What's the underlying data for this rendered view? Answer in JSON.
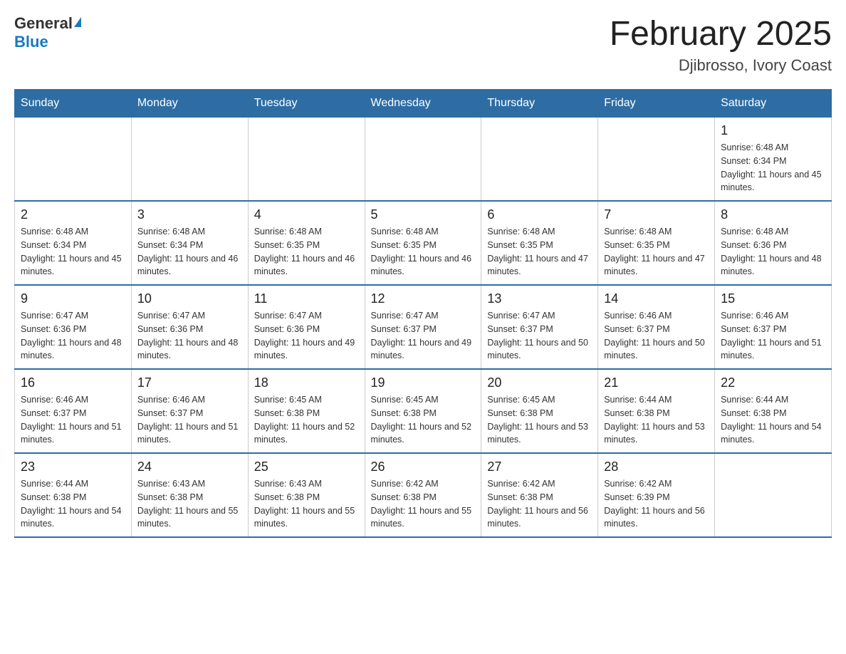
{
  "header": {
    "logo_general": "General",
    "logo_blue": "Blue",
    "month_title": "February 2025",
    "location": "Djibrosso, Ivory Coast"
  },
  "days_of_week": [
    "Sunday",
    "Monday",
    "Tuesday",
    "Wednesday",
    "Thursday",
    "Friday",
    "Saturday"
  ],
  "weeks": [
    [
      {
        "day": "",
        "info": ""
      },
      {
        "day": "",
        "info": ""
      },
      {
        "day": "",
        "info": ""
      },
      {
        "day": "",
        "info": ""
      },
      {
        "day": "",
        "info": ""
      },
      {
        "day": "",
        "info": ""
      },
      {
        "day": "1",
        "info": "Sunrise: 6:48 AM\nSunset: 6:34 PM\nDaylight: 11 hours and 45 minutes."
      }
    ],
    [
      {
        "day": "2",
        "info": "Sunrise: 6:48 AM\nSunset: 6:34 PM\nDaylight: 11 hours and 45 minutes."
      },
      {
        "day": "3",
        "info": "Sunrise: 6:48 AM\nSunset: 6:34 PM\nDaylight: 11 hours and 46 minutes."
      },
      {
        "day": "4",
        "info": "Sunrise: 6:48 AM\nSunset: 6:35 PM\nDaylight: 11 hours and 46 minutes."
      },
      {
        "day": "5",
        "info": "Sunrise: 6:48 AM\nSunset: 6:35 PM\nDaylight: 11 hours and 46 minutes."
      },
      {
        "day": "6",
        "info": "Sunrise: 6:48 AM\nSunset: 6:35 PM\nDaylight: 11 hours and 47 minutes."
      },
      {
        "day": "7",
        "info": "Sunrise: 6:48 AM\nSunset: 6:35 PM\nDaylight: 11 hours and 47 minutes."
      },
      {
        "day": "8",
        "info": "Sunrise: 6:48 AM\nSunset: 6:36 PM\nDaylight: 11 hours and 48 minutes."
      }
    ],
    [
      {
        "day": "9",
        "info": "Sunrise: 6:47 AM\nSunset: 6:36 PM\nDaylight: 11 hours and 48 minutes."
      },
      {
        "day": "10",
        "info": "Sunrise: 6:47 AM\nSunset: 6:36 PM\nDaylight: 11 hours and 48 minutes."
      },
      {
        "day": "11",
        "info": "Sunrise: 6:47 AM\nSunset: 6:36 PM\nDaylight: 11 hours and 49 minutes."
      },
      {
        "day": "12",
        "info": "Sunrise: 6:47 AM\nSunset: 6:37 PM\nDaylight: 11 hours and 49 minutes."
      },
      {
        "day": "13",
        "info": "Sunrise: 6:47 AM\nSunset: 6:37 PM\nDaylight: 11 hours and 50 minutes."
      },
      {
        "day": "14",
        "info": "Sunrise: 6:46 AM\nSunset: 6:37 PM\nDaylight: 11 hours and 50 minutes."
      },
      {
        "day": "15",
        "info": "Sunrise: 6:46 AM\nSunset: 6:37 PM\nDaylight: 11 hours and 51 minutes."
      }
    ],
    [
      {
        "day": "16",
        "info": "Sunrise: 6:46 AM\nSunset: 6:37 PM\nDaylight: 11 hours and 51 minutes."
      },
      {
        "day": "17",
        "info": "Sunrise: 6:46 AM\nSunset: 6:37 PM\nDaylight: 11 hours and 51 minutes."
      },
      {
        "day": "18",
        "info": "Sunrise: 6:45 AM\nSunset: 6:38 PM\nDaylight: 11 hours and 52 minutes."
      },
      {
        "day": "19",
        "info": "Sunrise: 6:45 AM\nSunset: 6:38 PM\nDaylight: 11 hours and 52 minutes."
      },
      {
        "day": "20",
        "info": "Sunrise: 6:45 AM\nSunset: 6:38 PM\nDaylight: 11 hours and 53 minutes."
      },
      {
        "day": "21",
        "info": "Sunrise: 6:44 AM\nSunset: 6:38 PM\nDaylight: 11 hours and 53 minutes."
      },
      {
        "day": "22",
        "info": "Sunrise: 6:44 AM\nSunset: 6:38 PM\nDaylight: 11 hours and 54 minutes."
      }
    ],
    [
      {
        "day": "23",
        "info": "Sunrise: 6:44 AM\nSunset: 6:38 PM\nDaylight: 11 hours and 54 minutes."
      },
      {
        "day": "24",
        "info": "Sunrise: 6:43 AM\nSunset: 6:38 PM\nDaylight: 11 hours and 55 minutes."
      },
      {
        "day": "25",
        "info": "Sunrise: 6:43 AM\nSunset: 6:38 PM\nDaylight: 11 hours and 55 minutes."
      },
      {
        "day": "26",
        "info": "Sunrise: 6:42 AM\nSunset: 6:38 PM\nDaylight: 11 hours and 55 minutes."
      },
      {
        "day": "27",
        "info": "Sunrise: 6:42 AM\nSunset: 6:38 PM\nDaylight: 11 hours and 56 minutes."
      },
      {
        "day": "28",
        "info": "Sunrise: 6:42 AM\nSunset: 6:39 PM\nDaylight: 11 hours and 56 minutes."
      },
      {
        "day": "",
        "info": ""
      }
    ]
  ]
}
